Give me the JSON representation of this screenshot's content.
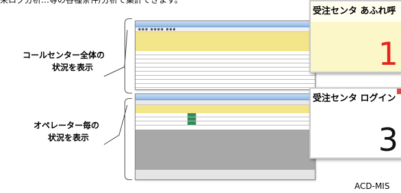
{
  "caption": "来ログ分析…等の各種条件/分析で集計できます。",
  "callouts": {
    "top": {
      "line1": "コールセンター全体の",
      "line2": "状況を表示"
    },
    "bottom": {
      "line1": "オペレーター毎の",
      "line2": "状況を表示"
    }
  },
  "popups": {
    "overflow": {
      "title": "受注センタ あふれ呼",
      "value": "1",
      "value_color": "#e8231c",
      "bg_color": "#fbf7c8"
    },
    "login": {
      "title": "受注センタ ログイン",
      "value": "3",
      "value_color": "#111111",
      "bg_color": "#ffffff"
    }
  },
  "footer": {
    "label": "ACD-MIS"
  },
  "colors": {
    "header_yellow": "#f3e58a",
    "window_title_blue": "#8fb8e6"
  }
}
